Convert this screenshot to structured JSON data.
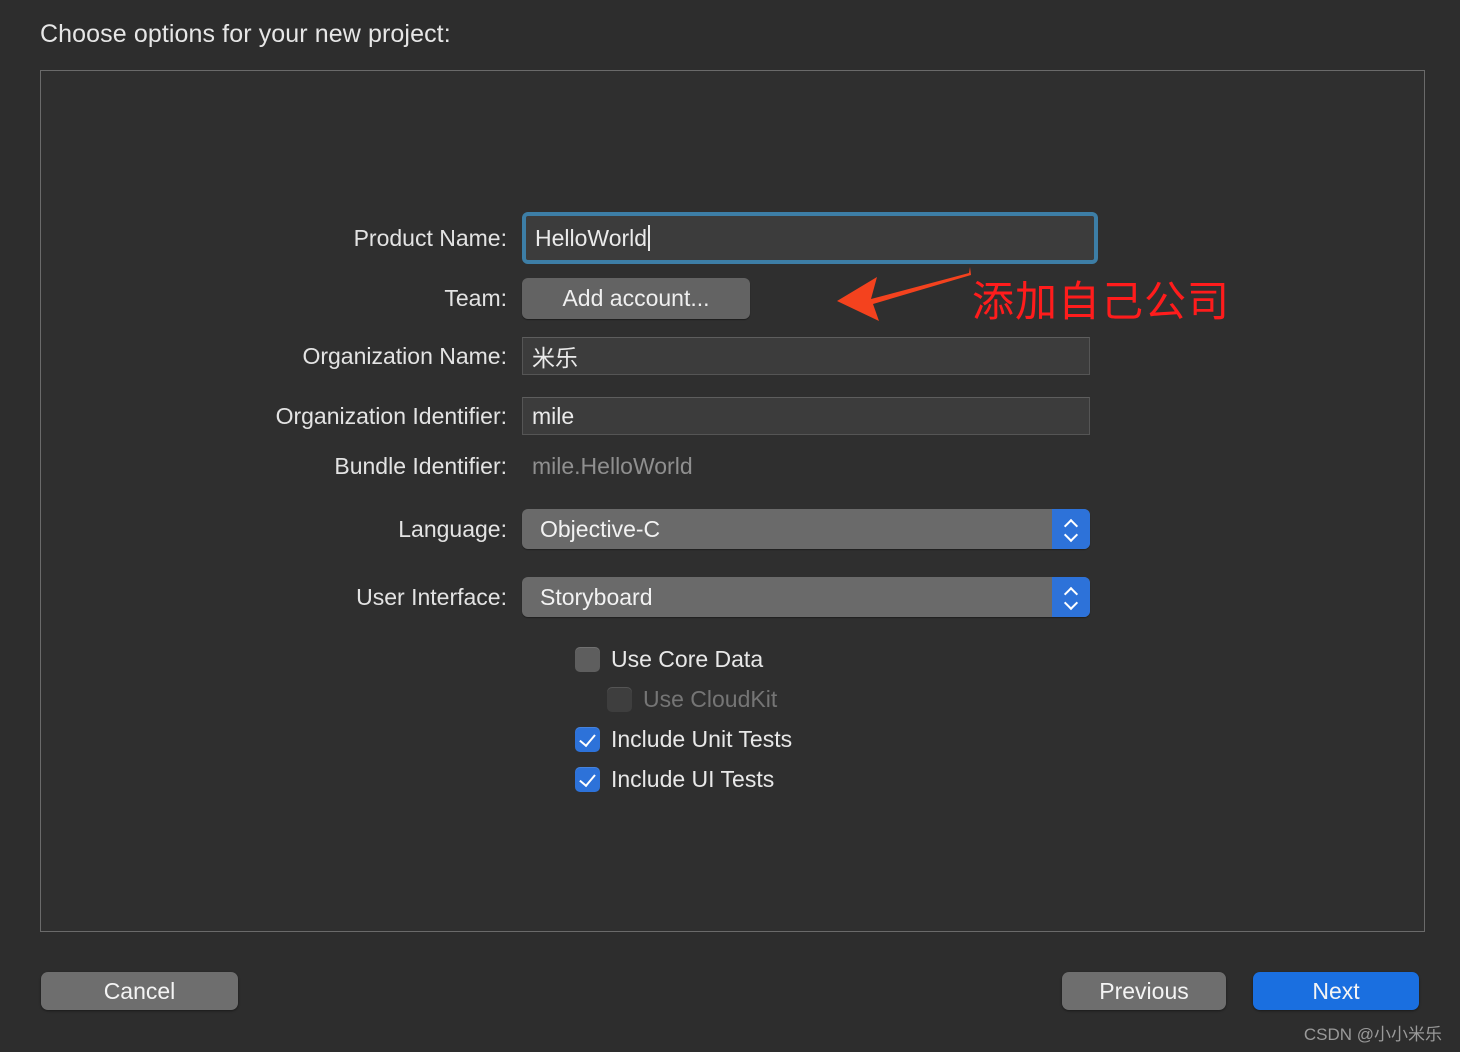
{
  "heading": "Choose options for your new project:",
  "form": {
    "rows": [
      {
        "label": "Product Name:",
        "value": "HelloWorld",
        "type": "textfield-focused"
      },
      {
        "label": "Team:",
        "value": "Add account...",
        "type": "button"
      },
      {
        "label": "Organization Name:",
        "value": "米乐",
        "type": "textfield"
      },
      {
        "label": "Organization Identifier:",
        "value": "mile",
        "type": "textfield"
      },
      {
        "label": "Bundle Identifier:",
        "value": "mile.HelloWorld",
        "type": "static"
      },
      {
        "label": "Language:",
        "value": "Objective-C",
        "type": "popup"
      },
      {
        "label": "User Interface:",
        "value": "Storyboard",
        "type": "popup"
      }
    ]
  },
  "checkboxes": [
    {
      "label": "Use Core Data",
      "checked": false,
      "disabled": false
    },
    {
      "label": "Use CloudKit",
      "checked": false,
      "disabled": true
    },
    {
      "label": "Include Unit Tests",
      "checked": true,
      "disabled": false
    },
    {
      "label": "Include UI Tests",
      "checked": true,
      "disabled": false
    }
  ],
  "annotation": {
    "text": "添加自己公司",
    "color": "#ff1c1c",
    "arrow_color": "#f4421e",
    "arrow_icon": "left-arrow-icon"
  },
  "footer": {
    "cancel_label": "Cancel",
    "previous_label": "Previous",
    "next_label": "Next"
  },
  "watermark": "CSDN @小小米乐",
  "colors": {
    "window_bg": "#2d2d2d",
    "panel_bg": "#2f2f2f",
    "panel_border": "#6a6a6a",
    "field_bg": "#3c3c3c",
    "focus_ring": "#3d7ea6",
    "accent_blue": "#2d72d9",
    "next_blue": "#1a6fe0",
    "button_gray": "#6e6e6e",
    "text_primary": "#e8e8e8",
    "text_disabled": "#8f8f8f"
  }
}
